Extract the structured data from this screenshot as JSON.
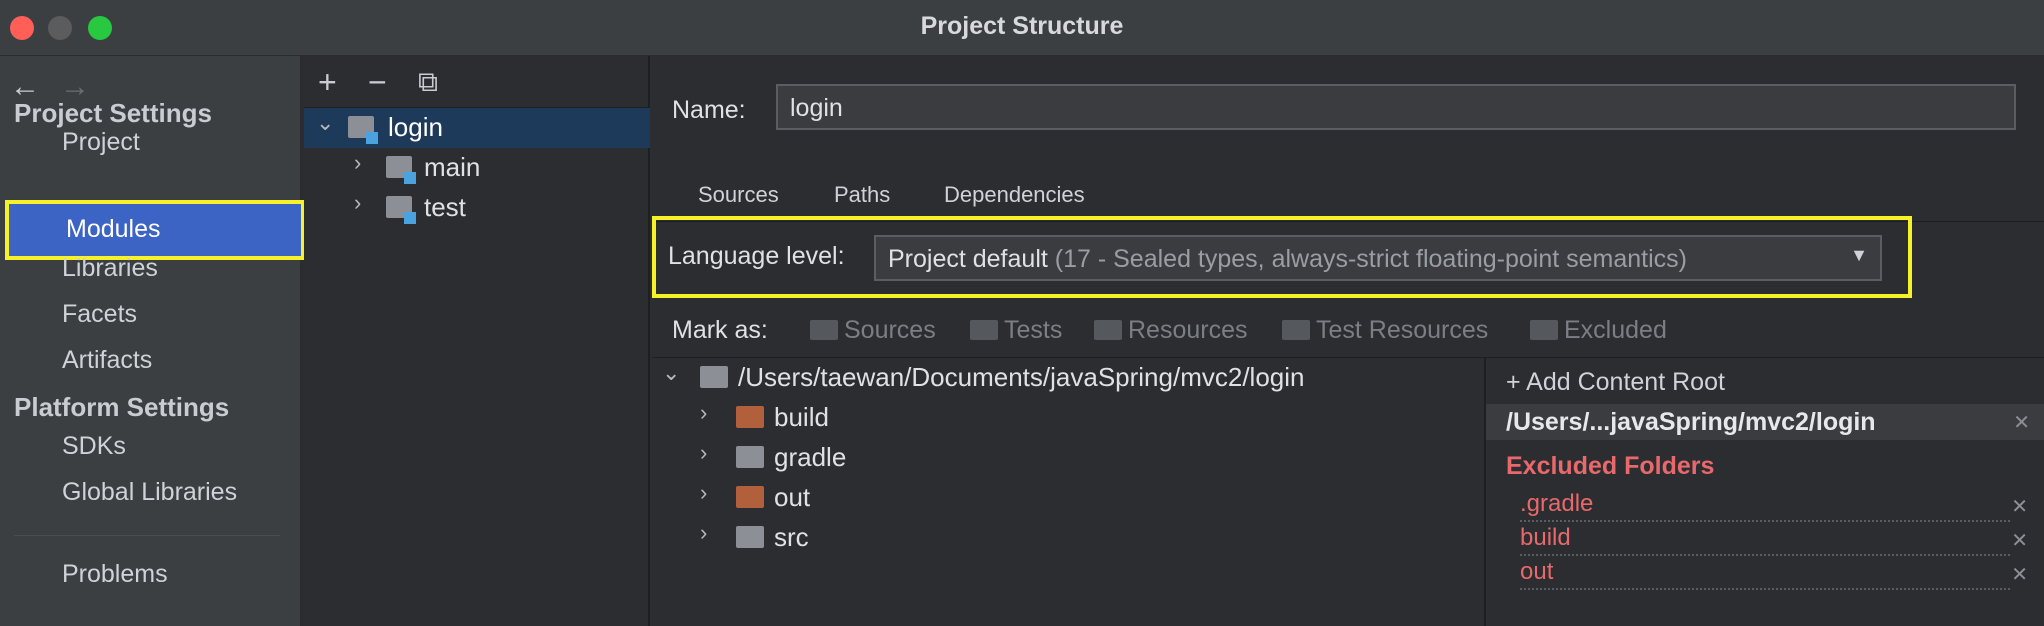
{
  "window": {
    "title": "Project Structure"
  },
  "sidebar": {
    "back_glyph": "←",
    "forward_glyph": "→",
    "project_settings_heading": "Project Settings",
    "project_settings_items": [
      "Project",
      "Modules",
      "Libraries",
      "Facets",
      "Artifacts"
    ],
    "platform_settings_heading": "Platform Settings",
    "platform_settings_items": [
      "SDKs",
      "Global Libraries"
    ],
    "problems": "Problems",
    "selected": "Modules"
  },
  "module_tree": {
    "toolbar": {
      "add": "+",
      "remove": "−",
      "copy": "⧉"
    },
    "root": "login",
    "children": [
      "main",
      "test"
    ]
  },
  "main": {
    "name_label": "Name:",
    "name_value": "login",
    "tabs": [
      "Sources",
      "Paths",
      "Dependencies"
    ],
    "active_tab": "Sources",
    "language_level_label": "Language level:",
    "language_level_value": "Project default",
    "language_level_detail": "(17 - Sealed types, always-strict floating-point semantics)",
    "mark_as_label": "Mark as:",
    "mark_as_options": [
      "Sources",
      "Tests",
      "Resources",
      "Test Resources",
      "Excluded"
    ]
  },
  "content_tree": {
    "root": "/Users/taewan/Documents/javaSpring/mvc2/login",
    "children": [
      {
        "label": "build",
        "folder": "excluded"
      },
      {
        "label": "gradle",
        "folder": "normal"
      },
      {
        "label": "out",
        "folder": "excluded"
      },
      {
        "label": "src",
        "folder": "normal"
      }
    ]
  },
  "content_root_panel": {
    "add_content_root": "Add Content Root",
    "root_path": "/Users/...javaSpring/mvc2/login",
    "excluded_heading": "Excluded Folders",
    "excluded": [
      ".gradle",
      "build",
      "out"
    ]
  },
  "colors": {
    "accent": "#3b64c4",
    "highlight_box": "#f7f12a",
    "excluded": "#e7696b"
  }
}
